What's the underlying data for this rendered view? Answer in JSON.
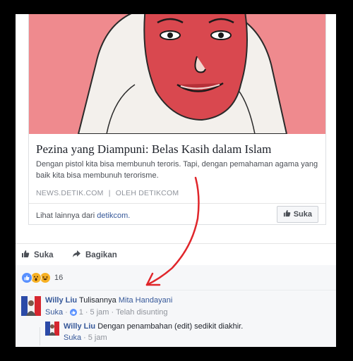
{
  "card": {
    "title": "Pezina yang Diampuni: Belas Kasih dalam Islam",
    "description": "Dengan pistol kita bisa membunuh teroris. Tapi, dengan pemahaman agama yang baik kita bisa membunuh terorisme.",
    "source": "NEWS.DETIK.COM",
    "separator": "|",
    "author": "OLEH DETIKCOM",
    "more_prefix": "Lihat lainnya dari",
    "more_link": "detikcom.",
    "like_button": "Suka"
  },
  "actions": {
    "like": "Suka",
    "share": "Bagikan"
  },
  "reactions": {
    "icons": [
      "like-reaction",
      "wow-reaction",
      "haha-reaction"
    ],
    "count": "16"
  },
  "comments": [
    {
      "author": "Willy Liu",
      "text": "Tulisannya",
      "mention": "Mita Handayani",
      "like": "Suka",
      "dot": "·",
      "like_count": "1",
      "time": "5 jam",
      "edited": "Telah disunting"
    },
    {
      "author": "Willy Liu",
      "text": "Dengan penambahan (edit) sedikit diakhir.",
      "like": "Suka",
      "dot": "·",
      "time": "5 jam"
    }
  ],
  "colors": {
    "link": "#365899",
    "annotation_arrow": "#e0262b",
    "illustration_bg": "#ef8a8e"
  }
}
